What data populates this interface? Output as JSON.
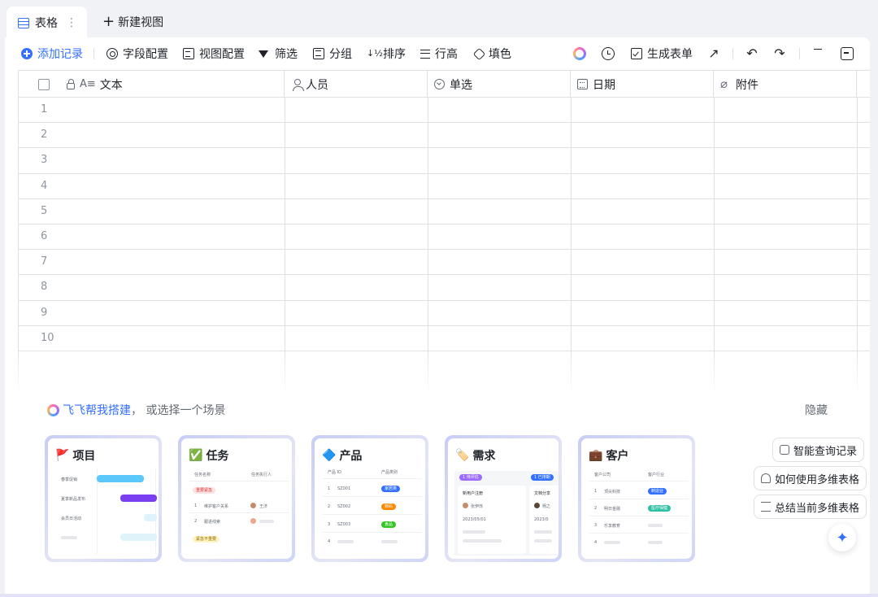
{
  "tabs": {
    "active_label": "表格",
    "more": "⋮",
    "new_view_label": "新建视图",
    "new_view_plus": "+"
  },
  "toolbar": {
    "add_record": "添加记录",
    "field_config": "字段配置",
    "view_config": "视图配置",
    "filter": "筛选",
    "group": "分组",
    "sort": "排序",
    "sort_glyph": "↓½",
    "row_height": "行高",
    "fill_color": "填色",
    "generate_form": "生成表单",
    "share_glyph": "↗",
    "undo_glyph": "↶",
    "redo_glyph": "↷"
  },
  "grid": {
    "columns": [
      {
        "label": "文本",
        "prefix": "A≡"
      },
      {
        "label": "人员"
      },
      {
        "label": "单选"
      },
      {
        "label": "日期"
      },
      {
        "label": "附件"
      }
    ],
    "attach_glyph": "⌀",
    "rows": [
      "1",
      "2",
      "3",
      "4",
      "5",
      "6",
      "7",
      "8",
      "9",
      "10"
    ]
  },
  "scenarios": {
    "link_text": "飞飞帮我搭建",
    "rest_text": "， 或选择一个场景",
    "hide_label": "隐藏",
    "cards": [
      {
        "title": "项目",
        "emoji": "🚩",
        "items": [
          "春季促销",
          "夏季新品发布",
          "会员日活动"
        ]
      },
      {
        "title": "任务",
        "emoji": "✅",
        "col1": "任务名称",
        "col2": "任务执行人",
        "badge1": "重要紧急",
        "rows": [
          {
            "n": "1",
            "name": "维护客户关系",
            "who": "王济"
          },
          {
            "n": "2",
            "name": "跟进线索"
          }
        ],
        "badge2": "紧急不重要"
      },
      {
        "title": "产品",
        "emoji": "🔷",
        "col1": "产品 ID",
        "col2": "产品类别",
        "rows": [
          {
            "n": "1",
            "id": "SZ001",
            "tag": "家居类",
            "color": "#3370ff"
          },
          {
            "n": "2",
            "id": "SZ002",
            "tag": "数码",
            "color": "#ff8800"
          },
          {
            "n": "3",
            "id": "SZ003",
            "tag": "食品",
            "color": "#34c724"
          },
          {
            "n": "4"
          }
        ]
      },
      {
        "title": "需求",
        "emoji": "🏷️",
        "tag1": "1 待评估",
        "tag2": "1 已排期",
        "item1": "新用户注册",
        "item2": "文档分享",
        "who1": "张伊烁",
        "who2": "杨之",
        "date1": "2023/05/01",
        "date2": "2023/0"
      },
      {
        "title": "客户",
        "emoji": "💼",
        "col1": "客户公司",
        "col2": "客户行业",
        "rows": [
          {
            "n": "1",
            "name": "顶尖科技",
            "tag": "制造业",
            "color": "#3370ff"
          },
          {
            "n": "2",
            "name": "明日金融",
            "tag": "医疗保健",
            "color": "#2ebfa5"
          },
          {
            "n": "3",
            "name": "乐享教育"
          },
          {
            "n": "4"
          }
        ]
      }
    ]
  },
  "ai_actions": {
    "query": "智能查询记录",
    "howto": "如何使用多维表格",
    "summary": "总结当前多维表格",
    "fab_glyph": "✦"
  },
  "colors": {
    "accent": "#3370ff",
    "gantt_blue": "#5ac8fa",
    "gantt_purple": "#7b3ff2",
    "badge_red": "#f54a45",
    "badge_yellow": "#ffe28a"
  }
}
